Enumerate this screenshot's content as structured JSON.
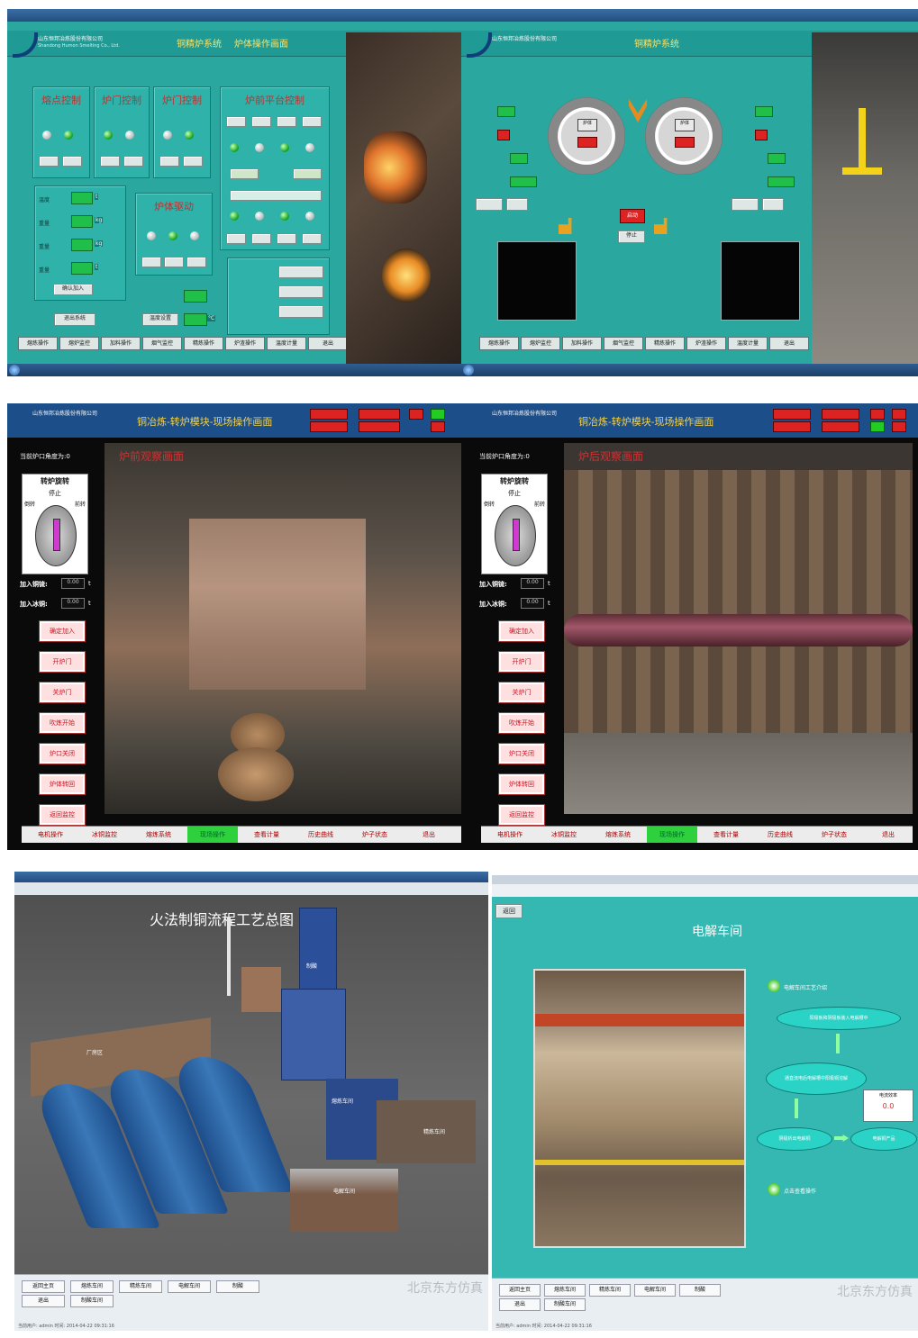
{
  "panels": {
    "p1": {
      "company": "山东恒邦冶炼股份有限公司",
      "company_en": "Shandong Humon Smelting Co., Ltd.",
      "title_a": "铜精炉系统",
      "title_b": "炉体操作画面",
      "groups": [
        "熔点控制",
        "炉门控制",
        "炉门控制",
        "炉前平台控制",
        "炉体驱动"
      ],
      "fields": [
        "温度",
        "重量",
        "重量",
        "重量"
      ],
      "units": [
        "t",
        "kg",
        "kg",
        "t"
      ],
      "buttons": [
        "确认加入",
        "退出系统",
        "温度设置"
      ],
      "temp_unit": "°C",
      "nav": [
        "熔炼操作",
        "熔炉监控",
        "加料操作",
        "烟气监控",
        "精炼操作",
        "炉渣操作",
        "温度计量",
        "退出"
      ]
    },
    "p2": {
      "company": "山东恒邦冶炼股份有限公司",
      "title": "铜精炉系统",
      "left_label": "炉体",
      "right_label": "炉体",
      "btn_start": "启动",
      "btn_stop": "停止",
      "nav": [
        "熔炼操作",
        "熔炉监控",
        "加料操作",
        "烟气监控",
        "精炼操作",
        "炉渣操作",
        "温度计量",
        "退出"
      ]
    },
    "p3": {
      "company": "山东恒邦冶炼股份有限公司",
      "title": "铜冶炼-转炉模块-现场操作画面",
      "status": "当前炉口角度为:0",
      "rot_title": "转炉旋转",
      "rot_stop": "停止",
      "rot_left": "倒转",
      "rot_right": "前转",
      "feed1": "加入铜锍:",
      "feed2": "加入冰铜:",
      "val": "0.00",
      "unit": "t",
      "scene_label": "炉前观察画面",
      "side_buttons": [
        "确定加入",
        "开炉门",
        "关炉门",
        "吹炼开始",
        "炉口关闭",
        "炉体转回",
        "返回监控"
      ],
      "nav": [
        "电机操作",
        "冰铜监控",
        "熔炼系统",
        "现场操作",
        "查看计量",
        "历史曲线",
        "炉子状态",
        "退出"
      ]
    },
    "p4": {
      "company": "山东恒邦冶炼股份有限公司",
      "title": "铜冶炼-转炉模块-现场操作画面",
      "status": "当前炉口角度为:0",
      "rot_title": "转炉旋转",
      "rot_stop": "停止",
      "rot_left": "倒转",
      "rot_right": "前转",
      "feed1": "加入铜锍:",
      "feed2": "加入冰铜:",
      "val": "0.00",
      "unit": "t",
      "scene_label": "炉后观察画面",
      "side_buttons": [
        "确定加入",
        "开炉门",
        "关炉门",
        "吹炼开始",
        "炉口关闭",
        "炉体转回",
        "返回监控"
      ],
      "nav": [
        "电机操作",
        "冰铜监控",
        "熔炼系统",
        "现场操作",
        "查看计量",
        "历史曲线",
        "炉子状态",
        "退出"
      ]
    },
    "p5": {
      "title": "火法制铜流程工艺总图",
      "labels": [
        "厂房区",
        "熔炼车间",
        "制酸",
        "电解车间",
        "精炼车间"
      ],
      "buttons": [
        "返回主页",
        "熔炼车间",
        "精炼车间",
        "电解车间",
        "制酸",
        "退出",
        "制酸车间"
      ],
      "logo": "北京东方仿真",
      "footer": "当前用户: admin    时间: 2014-04-22 09:31:16"
    },
    "p6": {
      "back_btn": "返回",
      "title": "电解车间",
      "flow": [
        "电解车间工艺介绍",
        "阳极板和阴极板装入电解槽中",
        "通直流电后电解槽中阳极铜溶解",
        "阴极析出电解铜",
        "电解铜产品"
      ],
      "bullet2": "点击查看操作",
      "val_title": "电流效率",
      "val": "0.0",
      "buttons": [
        "返回主页",
        "熔炼车间",
        "精炼车间",
        "电解车间",
        "制酸",
        "退出",
        "制酸车间"
      ],
      "logo": "北京东方仿真",
      "footer": "当前用户: admin    时间: 2014-04-22 09:31:16"
    }
  }
}
